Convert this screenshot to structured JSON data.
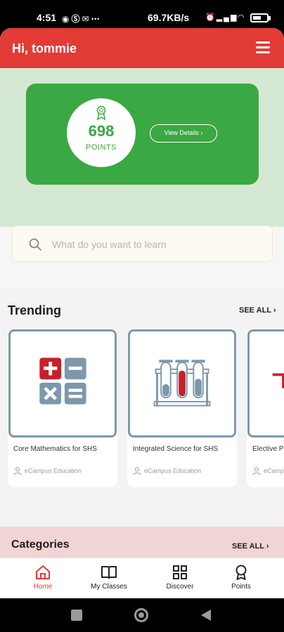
{
  "status_bar": {
    "time": "4:51",
    "left_icons": [
      "whatsapp-icon",
      "skype-icon",
      "mail-icon",
      "more-icon"
    ],
    "net_speed": "69.7KB/s",
    "right_icons": [
      "alarm-icon",
      "signal-icon",
      "signal-icon",
      "wifi-icon",
      "battery-icon"
    ],
    "battery_level": 0.6
  },
  "header": {
    "greeting": "Hi, tommie",
    "menu_icon": "hamburger-icon",
    "bg_color": "#e23b35"
  },
  "points": {
    "value": "698",
    "label": "POINTS",
    "view_details_label": "View Details ›",
    "card_color": "#3aa843"
  },
  "search": {
    "placeholder": "What do you want to learn"
  },
  "trending": {
    "title": "Trending",
    "see_all": "SEE ALL ›",
    "courses": [
      {
        "title": "Core Mathematics for SHS",
        "org": "eCampus Education",
        "icon": "math-operators-icon"
      },
      {
        "title": "Integrated Science for SHS",
        "org": "eCampus Education",
        "icon": "test-tubes-icon"
      },
      {
        "title": "Elective Physics for SHS",
        "org": "eCampus Education",
        "icon": "physics-icon"
      }
    ]
  },
  "categories": {
    "title": "Categories",
    "see_all": "SEE ALL ›"
  },
  "bottom_nav": {
    "items": [
      {
        "label": "Home",
        "icon": "home-icon",
        "active": true
      },
      {
        "label": "My Classes",
        "icon": "book-icon",
        "active": false
      },
      {
        "label": "Discover",
        "icon": "grid-icon",
        "active": false
      },
      {
        "label": "Points",
        "icon": "medal-icon",
        "active": false
      }
    ]
  },
  "system_nav": {
    "buttons": [
      "recents-button",
      "home-button",
      "back-button"
    ]
  }
}
